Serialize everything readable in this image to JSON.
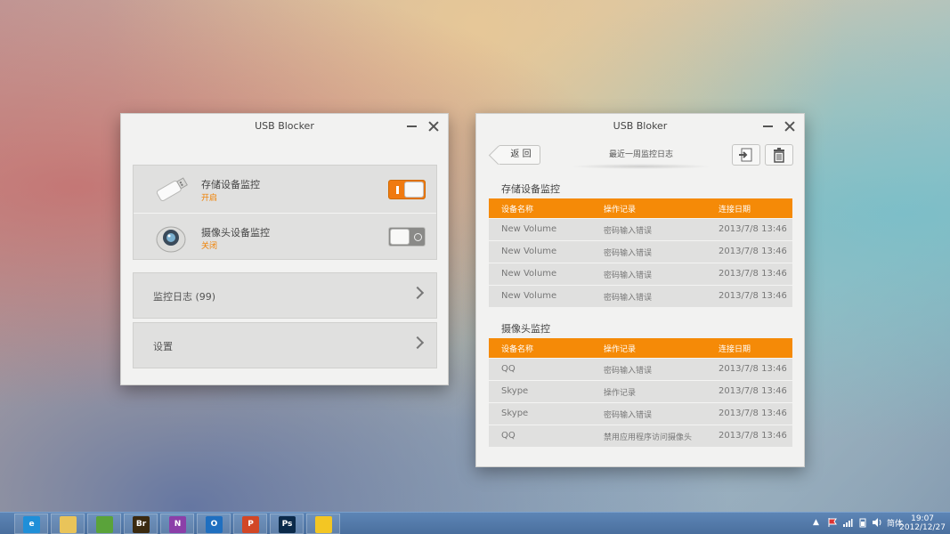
{
  "window_left": {
    "title": "USB Blocker",
    "devices": [
      {
        "name": "存储设备监控",
        "status": "开启",
        "enabled": true,
        "icon": "usb-drive-icon"
      },
      {
        "name": "摄像头设备监控",
        "status": "关闭",
        "enabled": false,
        "icon": "webcam-icon"
      }
    ],
    "nav": [
      {
        "label": "监控日志 (99)"
      },
      {
        "label": "设置"
      }
    ]
  },
  "window_right": {
    "title": "USB Bloker",
    "back_label": "返 回",
    "page_title": "最近一周监控日志",
    "storage_section": {
      "title": "存储设备监控",
      "headers": [
        "设备名称",
        "操作记录",
        "连接日期"
      ],
      "rows": [
        {
          "device": "New Volume",
          "action": "密码输入错误",
          "date": "2013/7/8  13:46"
        },
        {
          "device": "New Volume",
          "action": "密码输入错误",
          "date": "2013/7/8  13:46"
        },
        {
          "device": "New Volume",
          "action": "密码输入错误",
          "date": "2013/7/8  13:46"
        },
        {
          "device": "New Volume",
          "action": "密码输入错误",
          "date": "2013/7/8  13:46"
        }
      ]
    },
    "camera_section": {
      "title": "摄像头监控",
      "headers": [
        "设备名称",
        "操作记录",
        "连接日期"
      ],
      "rows": [
        {
          "device": "QQ",
          "action": "密码输入错误",
          "date": "2013/7/8  13:46"
        },
        {
          "device": "Skype",
          "action": "操作记录",
          "date": "2013/7/8  13:46"
        },
        {
          "device": "Skype",
          "action": "密码输入错误",
          "date": "2013/7/8  13:46"
        },
        {
          "device": "QQ",
          "action": "禁用应用程序访问摄像头",
          "date": "2013/7/8  13:46"
        }
      ]
    }
  },
  "taskbar": {
    "apps": [
      {
        "icon": "internet-explorer-icon",
        "glyph": "e",
        "color": "#1f8fd8"
      },
      {
        "icon": "file-explorer-icon",
        "glyph": "",
        "color": "#e9c45a"
      },
      {
        "icon": "evernote-icon",
        "glyph": "",
        "color": "#5aa33a"
      },
      {
        "icon": "adobe-bridge-icon",
        "glyph": "Br",
        "color": "#3b2a10"
      },
      {
        "icon": "onenote-icon",
        "glyph": "N",
        "color": "#8b3fa8"
      },
      {
        "icon": "outlook-icon",
        "glyph": "O",
        "color": "#1f6fc0"
      },
      {
        "icon": "powerpoint-icon",
        "glyph": "P",
        "color": "#d24726"
      },
      {
        "icon": "photoshop-icon",
        "glyph": "Ps",
        "color": "#0b2a4a"
      },
      {
        "icon": "sticky-notes-icon",
        "glyph": "",
        "color": "#f3c623"
      }
    ],
    "ime": "简体",
    "time": "19:07",
    "date": "2012/12/27"
  },
  "colors": {
    "accent": "#f58a07"
  }
}
